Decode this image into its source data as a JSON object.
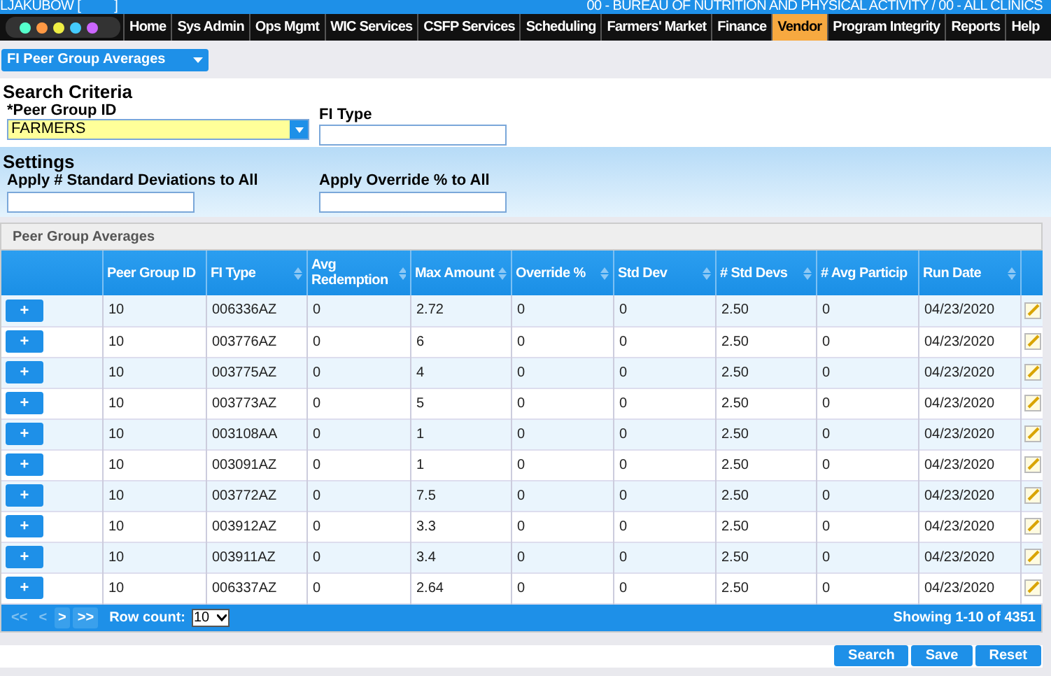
{
  "header": {
    "user": "LJAKUBOW [",
    "user_close": "]",
    "agency": "00 - BUREAU OF NUTRITION AND PHYSICAL ACTIVITY / 00 - ALL CLINICS"
  },
  "nav": [
    {
      "label": "Home",
      "selected": false
    },
    {
      "label": "Sys Admin",
      "selected": false
    },
    {
      "label": "Ops Mgmt",
      "selected": false
    },
    {
      "label": "WIC Services",
      "selected": false
    },
    {
      "label": "CSFP Services",
      "selected": false
    },
    {
      "label": "Scheduling",
      "selected": false
    },
    {
      "label": "Farmers' Market",
      "selected": false
    },
    {
      "label": "Finance",
      "selected": false
    },
    {
      "label": "Vendor",
      "selected": true
    },
    {
      "label": "Program Integrity",
      "selected": false
    },
    {
      "label": "Reports",
      "selected": false
    },
    {
      "label": "Help",
      "selected": false
    }
  ],
  "page_select": "FI Peer Group Averages",
  "search_criteria": {
    "title": "Search Criteria",
    "peer_group_label": "*Peer Group ID",
    "peer_group_value": "FARMERS",
    "fi_type_label": "FI Type"
  },
  "settings": {
    "title": "Settings",
    "std_dev_label": "Apply # Standard Deviations to All",
    "override_label": "Apply Override % to All"
  },
  "panel_title": "Peer Group Averages",
  "table": {
    "columns": [
      {
        "label": "Peer Group ID",
        "sortable": false
      },
      {
        "label": "FI Type",
        "sortable": true
      },
      {
        "label": "Avg Redemption",
        "sortable": true
      },
      {
        "label": "Max Amount",
        "sortable": true
      },
      {
        "label": "Override %",
        "sortable": true
      },
      {
        "label": "Std Dev",
        "sortable": true
      },
      {
        "label": "# Std Devs",
        "sortable": true
      },
      {
        "label": "# Avg Particip",
        "sortable": false
      },
      {
        "label": "Run Date",
        "sortable": true
      }
    ],
    "expand_label": "+",
    "rows": [
      [
        "10",
        "006336AZ",
        "0",
        "2.72",
        "0",
        "0",
        "2.50",
        "0",
        "04/23/2020"
      ],
      [
        "10",
        "003776AZ",
        "0",
        "6",
        "0",
        "0",
        "2.50",
        "0",
        "04/23/2020"
      ],
      [
        "10",
        "003775AZ",
        "0",
        "4",
        "0",
        "0",
        "2.50",
        "0",
        "04/23/2020"
      ],
      [
        "10",
        "003773AZ",
        "0",
        "5",
        "0",
        "0",
        "2.50",
        "0",
        "04/23/2020"
      ],
      [
        "10",
        "003108AA",
        "0",
        "1",
        "0",
        "0",
        "2.50",
        "0",
        "04/23/2020"
      ],
      [
        "10",
        "003091AZ",
        "0",
        "1",
        "0",
        "0",
        "2.50",
        "0",
        "04/23/2020"
      ],
      [
        "10",
        "003772AZ",
        "0",
        "7.5",
        "0",
        "0",
        "2.50",
        "0",
        "04/23/2020"
      ],
      [
        "10",
        "003912AZ",
        "0",
        "3.3",
        "0",
        "0",
        "2.50",
        "0",
        "04/23/2020"
      ],
      [
        "10",
        "003911AZ",
        "0",
        "3.4",
        "0",
        "0",
        "2.50",
        "0",
        "04/23/2020"
      ],
      [
        "10",
        "006337AZ",
        "0",
        "2.64",
        "0",
        "0",
        "2.50",
        "0",
        "04/23/2020"
      ]
    ]
  },
  "pager": {
    "buttons": [
      {
        "label": "<<",
        "disabled": true
      },
      {
        "label": "<",
        "disabled": true
      },
      {
        "label": ">",
        "disabled": false
      },
      {
        "label": ">>",
        "disabled": false
      }
    ],
    "row_count_label": "Row count:",
    "row_count": "10",
    "showing": "Showing 1-10 of 4351"
  },
  "actions": [
    "Search",
    "Save",
    "Reset"
  ]
}
